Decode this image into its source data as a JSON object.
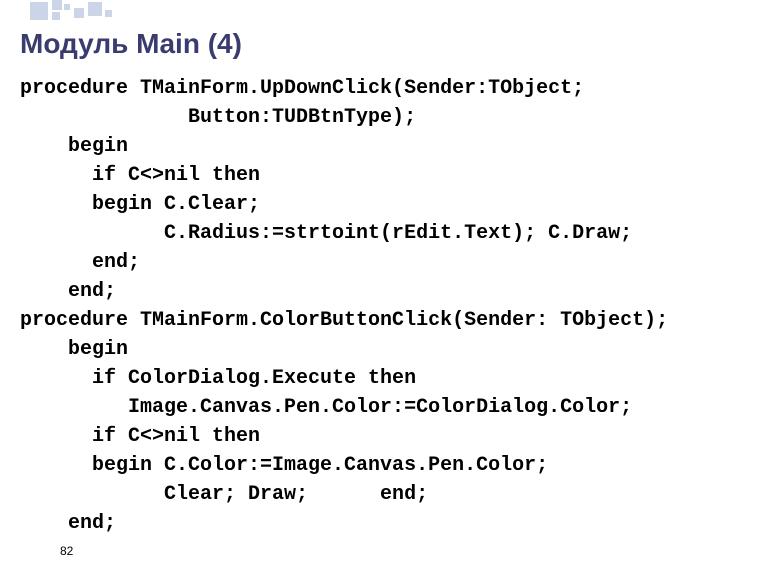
{
  "title": "Модуль Main (4)",
  "code_lines": [
    "procedure TMainForm.UpDownClick(Sender:TObject;",
    "              Button:TUDBtnType);",
    "    begin",
    "      if C<>nil then",
    "      begin C.Clear;",
    "            C.Radius:=strtoint(rEdit.Text); C.Draw;",
    "      end;",
    "    end;",
    "procedure TMainForm.ColorButtonClick(Sender: TObject);",
    "    begin",
    "      if ColorDialog.Execute then",
    "         Image.Canvas.Pen.Color:=ColorDialog.Color;",
    "      if C<>nil then",
    "      begin C.Color:=Image.Canvas.Pen.Color;",
    "            Clear; Draw;      end;",
    "    end;"
  ],
  "page_number": "82"
}
